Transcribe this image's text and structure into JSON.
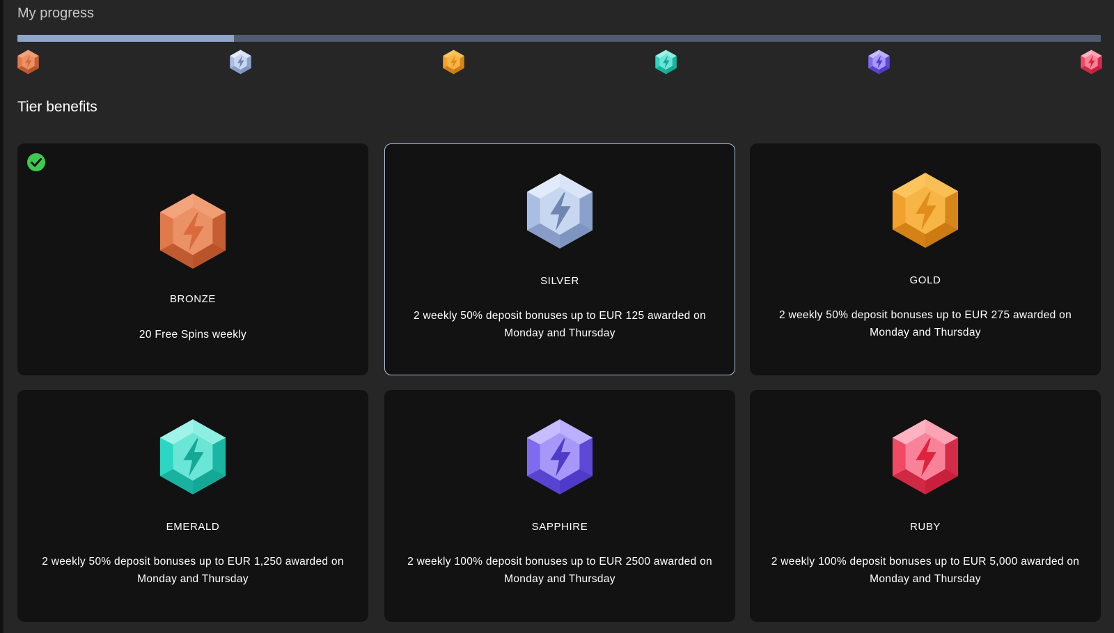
{
  "page": {
    "title": "My progress",
    "section_title": "Tier benefits"
  },
  "progress": {
    "fraction": 0.2,
    "fill_color": "#8ea4c8",
    "track_color": "#4f5b6e"
  },
  "milestones": [
    {
      "tier": "bronze",
      "icon": "bronze-gem-icon"
    },
    {
      "tier": "silver",
      "icon": "silver-gem-icon"
    },
    {
      "tier": "gold",
      "icon": "gold-gem-icon"
    },
    {
      "tier": "emerald",
      "icon": "emerald-gem-icon"
    },
    {
      "tier": "sapphire",
      "icon": "sapphire-gem-icon"
    },
    {
      "tier": "ruby",
      "icon": "ruby-gem-icon"
    }
  ],
  "tiers": [
    {
      "name": "BRONZE",
      "benefit": "20 Free Spins weekly",
      "icon": "bronze-gem-icon",
      "achieved": true,
      "selected": false,
      "colors": {
        "base": "#e07a4a",
        "light": "#f3a47c",
        "dark": "#b8532a",
        "bolt": "#d86a3c"
      }
    },
    {
      "name": "SILVER",
      "benefit": "2 weekly 50% deposit bonuses up to EUR 125 awarded on Monday and Thursday",
      "icon": "silver-gem-icon",
      "achieved": false,
      "selected": true,
      "colors": {
        "base": "#a9bee3",
        "light": "#e2ebfb",
        "dark": "#7e95c0",
        "bolt": "#6f86b2"
      }
    },
    {
      "name": "GOLD",
      "benefit": "2 weekly 50% deposit bonuses up to EUR 275 awarded on Monday and Thursday",
      "icon": "gold-gem-icon",
      "achieved": false,
      "selected": false,
      "colors": {
        "base": "#f2a22c",
        "light": "#fcc45c",
        "dark": "#cc7a12",
        "bolt": "#e08d1c"
      }
    },
    {
      "name": "EMERALD",
      "benefit": "2 weekly 50% deposit bonuses up to EUR 1,250 awarded on Monday and Thursday",
      "icon": "emerald-gem-icon",
      "achieved": false,
      "selected": false,
      "colors": {
        "base": "#2bd6c2",
        "light": "#9ff3e8",
        "dark": "#15a896",
        "bolt": "#15a896"
      }
    },
    {
      "name": "SAPPHIRE",
      "benefit": "2 weekly 100% deposit bonuses up to EUR 2500 awarded on Monday and Thursday",
      "icon": "sapphire-gem-icon",
      "achieved": false,
      "selected": false,
      "colors": {
        "base": "#7f6cf0",
        "light": "#c6bcff",
        "dark": "#4e3bc9",
        "bolt": "#4e3bc9"
      }
    },
    {
      "name": "RUBY",
      "benefit": "2 weekly 100% deposit bonuses up to EUR 5,000 awarded on Monday and Thursday",
      "icon": "ruby-gem-icon",
      "achieved": false,
      "selected": false,
      "colors": {
        "base": "#ef4a64",
        "light": "#ffb3c2",
        "dark": "#c8203c",
        "bolt": "#e0223c"
      }
    }
  ],
  "colors": {
    "background": "#262626",
    "card": "#121212",
    "selected_border": "#aebfdd",
    "check": "#3ec94f"
  }
}
